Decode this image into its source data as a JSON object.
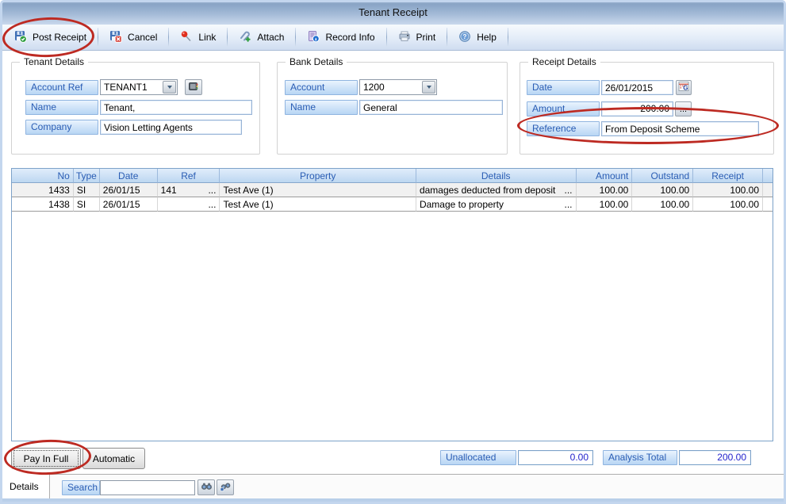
{
  "window": {
    "title": "Tenant Receipt"
  },
  "toolbar": {
    "buttons": [
      {
        "label": "Post Receipt"
      },
      {
        "label": "Cancel"
      },
      {
        "label": "Link"
      },
      {
        "label": "Attach"
      },
      {
        "label": "Record Info"
      },
      {
        "label": "Print"
      },
      {
        "label": "Help"
      }
    ]
  },
  "tenant_details": {
    "title": "Tenant Details",
    "account_ref_label": "Account Ref",
    "account_ref_value": "TENANT1",
    "name_label": "Name",
    "name_value": "Tenant,",
    "company_label": "Company",
    "company_value": "Vision Letting Agents"
  },
  "bank_details": {
    "title": "Bank Details",
    "account_label": "Account",
    "account_value": "1200",
    "name_label": "Name",
    "name_value": "General"
  },
  "receipt_details": {
    "title": "Receipt Details",
    "date_label": "Date",
    "date_value": "26/01/2015",
    "amount_label": "Amount",
    "amount_value": "200.00",
    "amount_more": "...",
    "reference_label": "Reference",
    "reference_value": "From Deposit Scheme"
  },
  "table": {
    "columns": [
      "No",
      "Type",
      "Date",
      "Ref",
      "Property",
      "Details",
      "Amount",
      "Outstand",
      "Receipt"
    ],
    "rows": [
      {
        "no": "1433",
        "type": "SI",
        "date": "26/01/15",
        "ref": "141",
        "ref_more": "...",
        "property": "Test Ave (1)",
        "details": "damages deducted from deposit",
        "details_more": "...",
        "amount": "100.00",
        "outstand": "100.00",
        "receipt": "100.00"
      },
      {
        "no": "1438",
        "type": "SI",
        "date": "26/01/15",
        "ref": "",
        "ref_more": "...",
        "property": "Test Ave (1)",
        "details": "Damage to property",
        "details_more": "...",
        "amount": "100.00",
        "outstand": "100.00",
        "receipt": "100.00"
      }
    ]
  },
  "footer": {
    "pay_in_full_label": "Pay In Full",
    "automatic_label": "Automatic",
    "unallocated_label": "Unallocated",
    "unallocated_value": "0.00",
    "analysis_total_label": "Analysis Total",
    "analysis_total_value": "200.00"
  },
  "bottom_bar": {
    "details_tab_label": "Details",
    "search_label": "Search",
    "search_value": ""
  },
  "colors": {
    "label_blue": "#2a5db4",
    "value_blue": "#2323cc",
    "annotation_red": "#bd2a22",
    "titlebar_blue": "#8aa5c6",
    "grid_header_blue": "#cfe2f6"
  }
}
